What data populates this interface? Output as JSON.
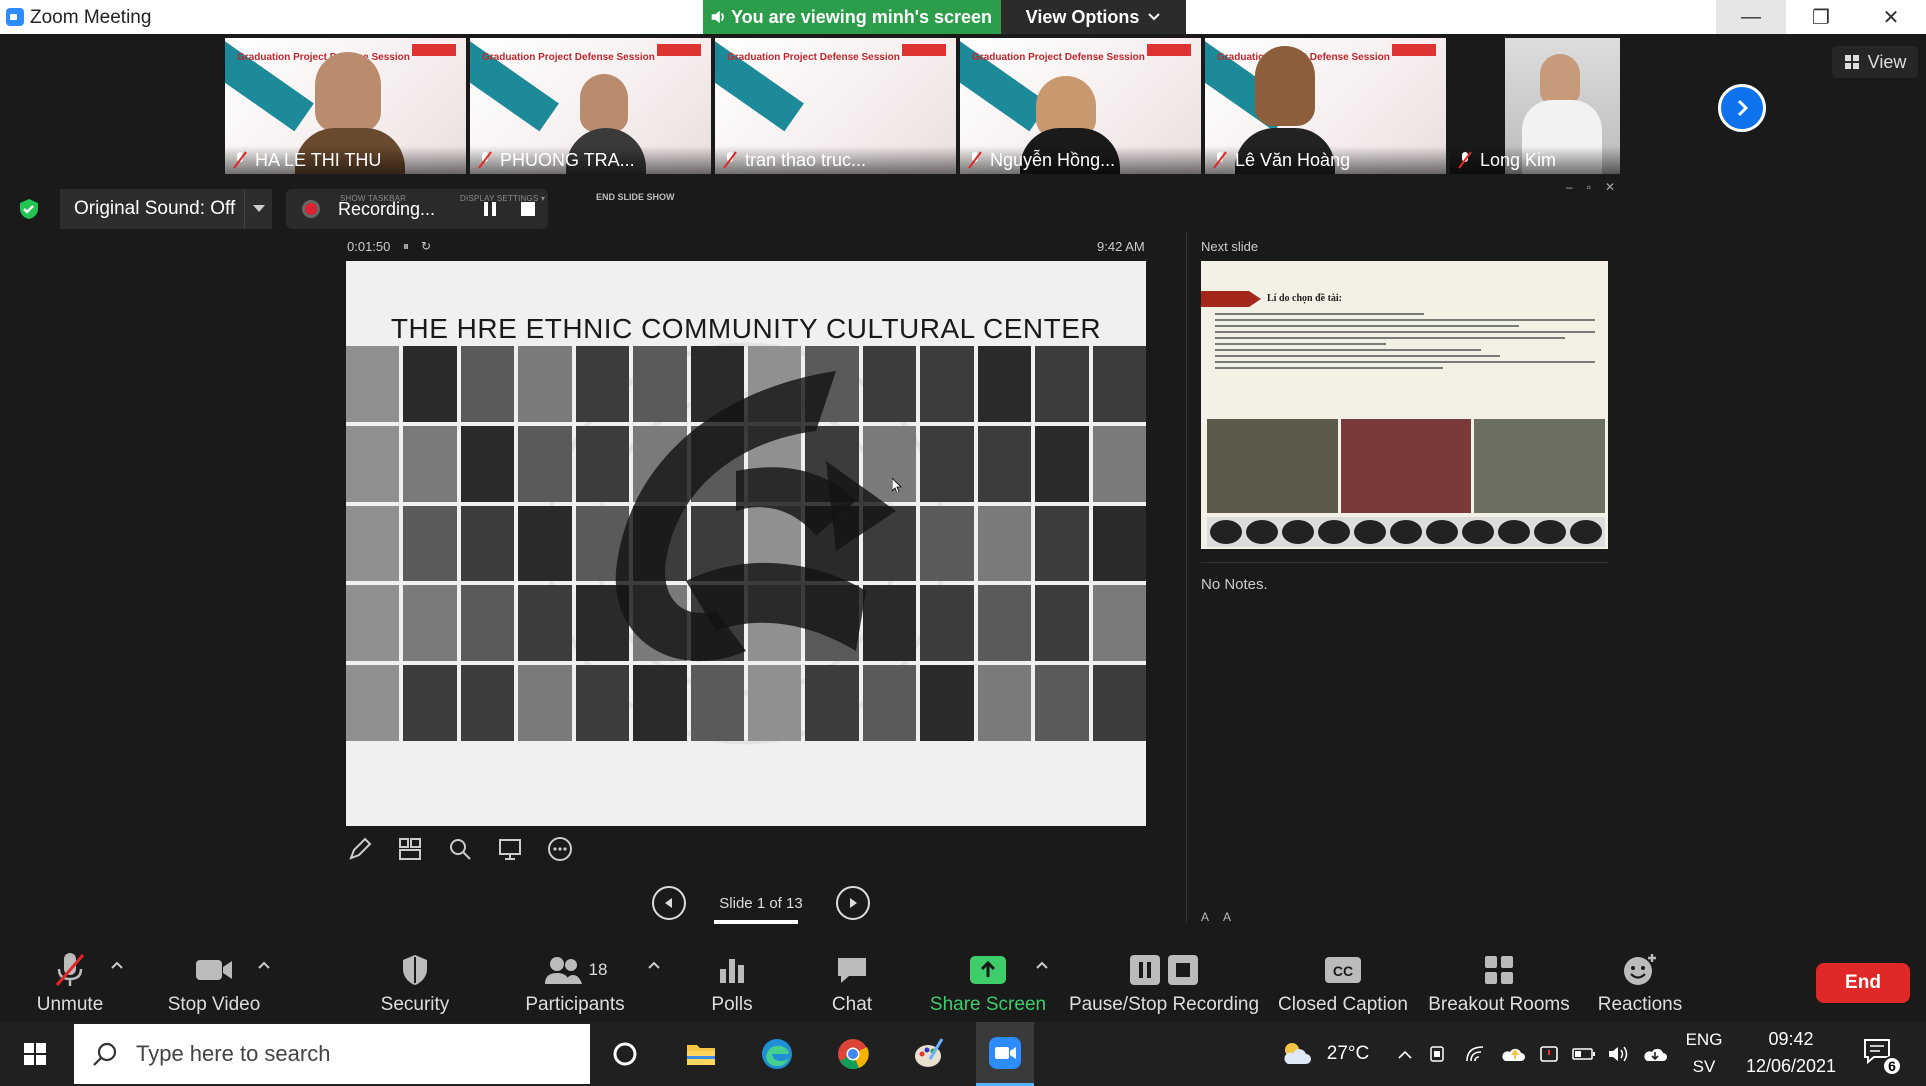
{
  "window": {
    "title": "Zoom Meeting",
    "minimize": "—",
    "restore": "❐",
    "close": "✕"
  },
  "banner": {
    "viewing": "You are viewing minh's screen",
    "view_options": "View Options"
  },
  "gallery": {
    "slide_header": "Graduation Project Defense Session",
    "participants": [
      {
        "name": "HA LE THI THU"
      },
      {
        "name": "PHUONG TRA..."
      },
      {
        "name": "tran thao truc..."
      },
      {
        "name": "Nguyễn Hồng..."
      },
      {
        "name": "Lê Văn Hoàng"
      },
      {
        "name": "Long Kim"
      }
    ],
    "view_label": "View"
  },
  "controls_row": {
    "original_sound": "Original Sound: Off",
    "recording": "Recording...",
    "show_taskbar": "SHOW TASKBAR",
    "display_settings": "DISPLAY SETTINGS ▾",
    "end_slide_show": "END SLIDE SHOW"
  },
  "presenter": {
    "timer": "0:01:50",
    "clock": "9:42 AM",
    "slide_title": "THE HRE ETHNIC COMMUNITY CULTURAL CENTER",
    "slide_counter": "Slide 1 of 13",
    "next_label": "Next slide",
    "next_slide_title": "Lí do chọn đề tài:",
    "notes": "No Notes."
  },
  "toolbar": {
    "unmute": "Unmute",
    "stop_video": "Stop Video",
    "security": "Security",
    "participants": "Participants",
    "participants_count": "18",
    "polls": "Polls",
    "chat": "Chat",
    "share_screen": "Share Screen",
    "pause_stop_recording": "Pause/Stop Recording",
    "closed_caption": "Closed Caption",
    "breakout_rooms": "Breakout Rooms",
    "reactions": "Reactions",
    "end": "End"
  },
  "taskbar": {
    "search_placeholder": "Type here to search",
    "temperature": "27°C",
    "lang_1": "ENG",
    "lang_2": "SV",
    "time": "09:42",
    "date": "12/06/2021",
    "notifications": "6"
  },
  "colors": {
    "zoom_blue": "#0e72ed",
    "banner_green": "#2c9e4b",
    "end_red": "#e02828",
    "share_green": "#3fcc6a"
  }
}
